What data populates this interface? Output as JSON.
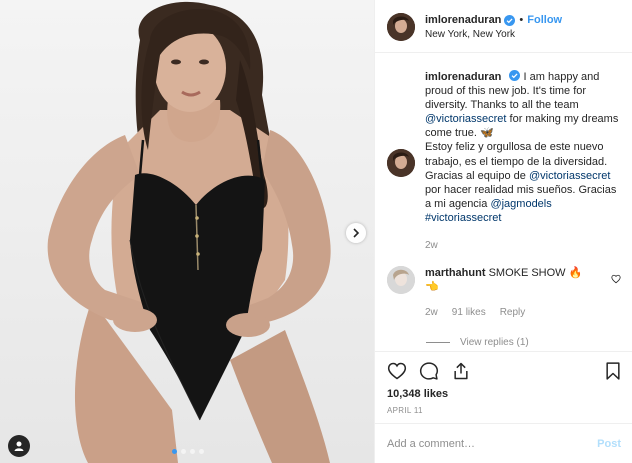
{
  "header": {
    "username": "imlorenaduran",
    "separator": "•",
    "follow_label": "Follow",
    "location": "New York, New York"
  },
  "caption": {
    "username": "imlorenaduran",
    "text_1": "I am happy and proud of this new job. It's time for diversity. Thanks to all the team",
    "mention_1": "@victoriassecret",
    "text_2": "for making my dreams come true. 🦋",
    "text_3": "Estoy feliz y orgullosa de este nuevo trabajo, es el tiempo de la diversidad. Gracias al equipo de",
    "mention_2": "@victoriassecret",
    "text_4": "por hacer realidad mis sueños. Gracias a mi agencia",
    "mention_3": "@jagmodels",
    "hashtag": "#victoriassecret",
    "age": "2w"
  },
  "comment": {
    "username": "marthahunt",
    "text": "SMOKE SHOW 🔥 👈",
    "age": "2w",
    "likes": "91 likes",
    "reply_label": "Reply",
    "view_replies": "View replies (1)"
  },
  "actions": {
    "likes_count": "10,348 likes",
    "date": "APRIL 11",
    "icons": [
      "heart-icon",
      "comment-icon",
      "share-icon",
      "bookmark-icon"
    ]
  },
  "add_comment": {
    "placeholder": "Add a comment…",
    "post_label": "Post"
  },
  "media": {
    "carousel_dots": 4,
    "active_dot": 0,
    "colors": {
      "accent": "#3897f0",
      "verified": "#3897f0",
      "post_disabled": "#b2dffc",
      "muted": "#8e8e8e"
    }
  }
}
